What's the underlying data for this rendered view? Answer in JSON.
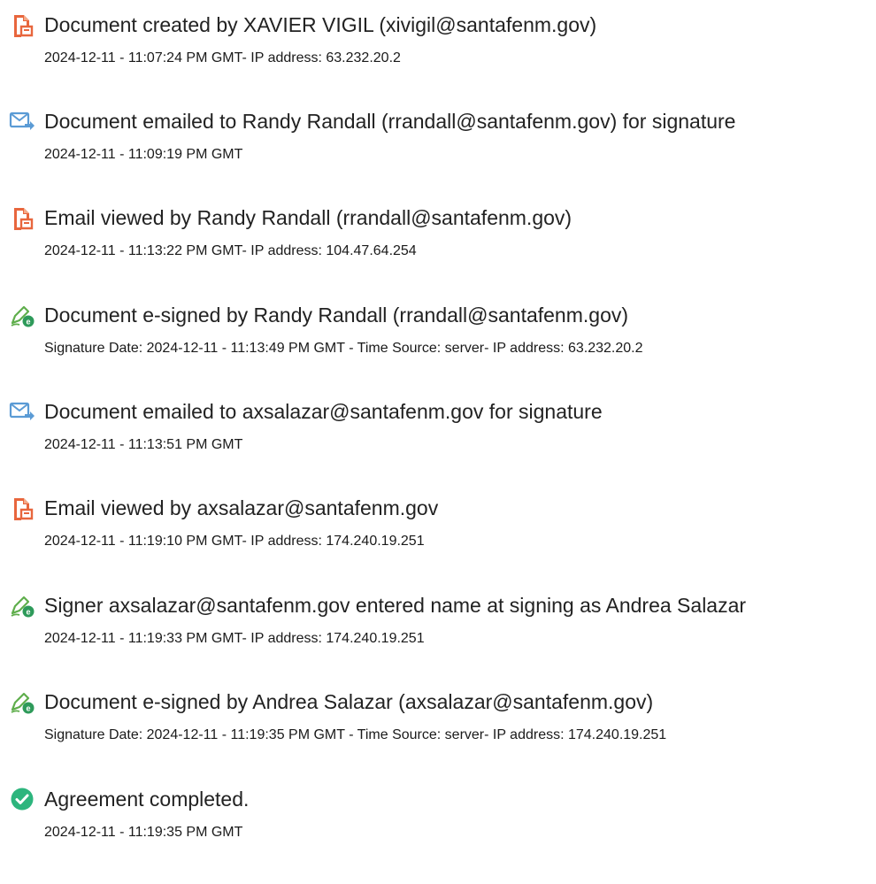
{
  "colors": {
    "document_icon": "#e8663d",
    "email_icon": "#5b9bd5",
    "sign_icon": "#4caf50",
    "complete_icon": "#2db57d",
    "text": "#222222"
  },
  "events": [
    {
      "icon": "document-icon",
      "title": "Document created by XAVIER VIGIL (xivigil@santafenm.gov)",
      "detail": "2024-12-11 - 11:07:24 PM GMT- IP address: 63.232.20.2"
    },
    {
      "icon": "email-icon",
      "title": "Document emailed to Randy Randall (rrandall@santafenm.gov) for signature",
      "detail": "2024-12-11 - 11:09:19 PM GMT"
    },
    {
      "icon": "document-icon",
      "title": "Email viewed by Randy Randall (rrandall@santafenm.gov)",
      "detail": "2024-12-11 - 11:13:22 PM GMT- IP address: 104.47.64.254"
    },
    {
      "icon": "pen-icon",
      "title": "Document e-signed by Randy Randall (rrandall@santafenm.gov)",
      "detail": "Signature Date: 2024-12-11 - 11:13:49 PM GMT - Time Source: server- IP address: 63.232.20.2"
    },
    {
      "icon": "email-icon",
      "title": "Document emailed to axsalazar@santafenm.gov for signature",
      "detail": "2024-12-11 - 11:13:51 PM GMT"
    },
    {
      "icon": "document-icon",
      "title": "Email viewed by axsalazar@santafenm.gov",
      "detail": "2024-12-11 - 11:19:10 PM GMT- IP address: 174.240.19.251"
    },
    {
      "icon": "pen-icon",
      "title": "Signer axsalazar@santafenm.gov entered name at signing as Andrea Salazar",
      "detail": "2024-12-11 - 11:19:33 PM GMT- IP address: 174.240.19.251"
    },
    {
      "icon": "pen-icon",
      "title": "Document e-signed by Andrea Salazar (axsalazar@santafenm.gov)",
      "detail": "Signature Date: 2024-12-11 - 11:19:35 PM GMT - Time Source: server- IP address: 174.240.19.251"
    },
    {
      "icon": "checkmark-icon",
      "title": "Agreement completed.",
      "detail": "2024-12-11 - 11:19:35 PM GMT"
    }
  ]
}
